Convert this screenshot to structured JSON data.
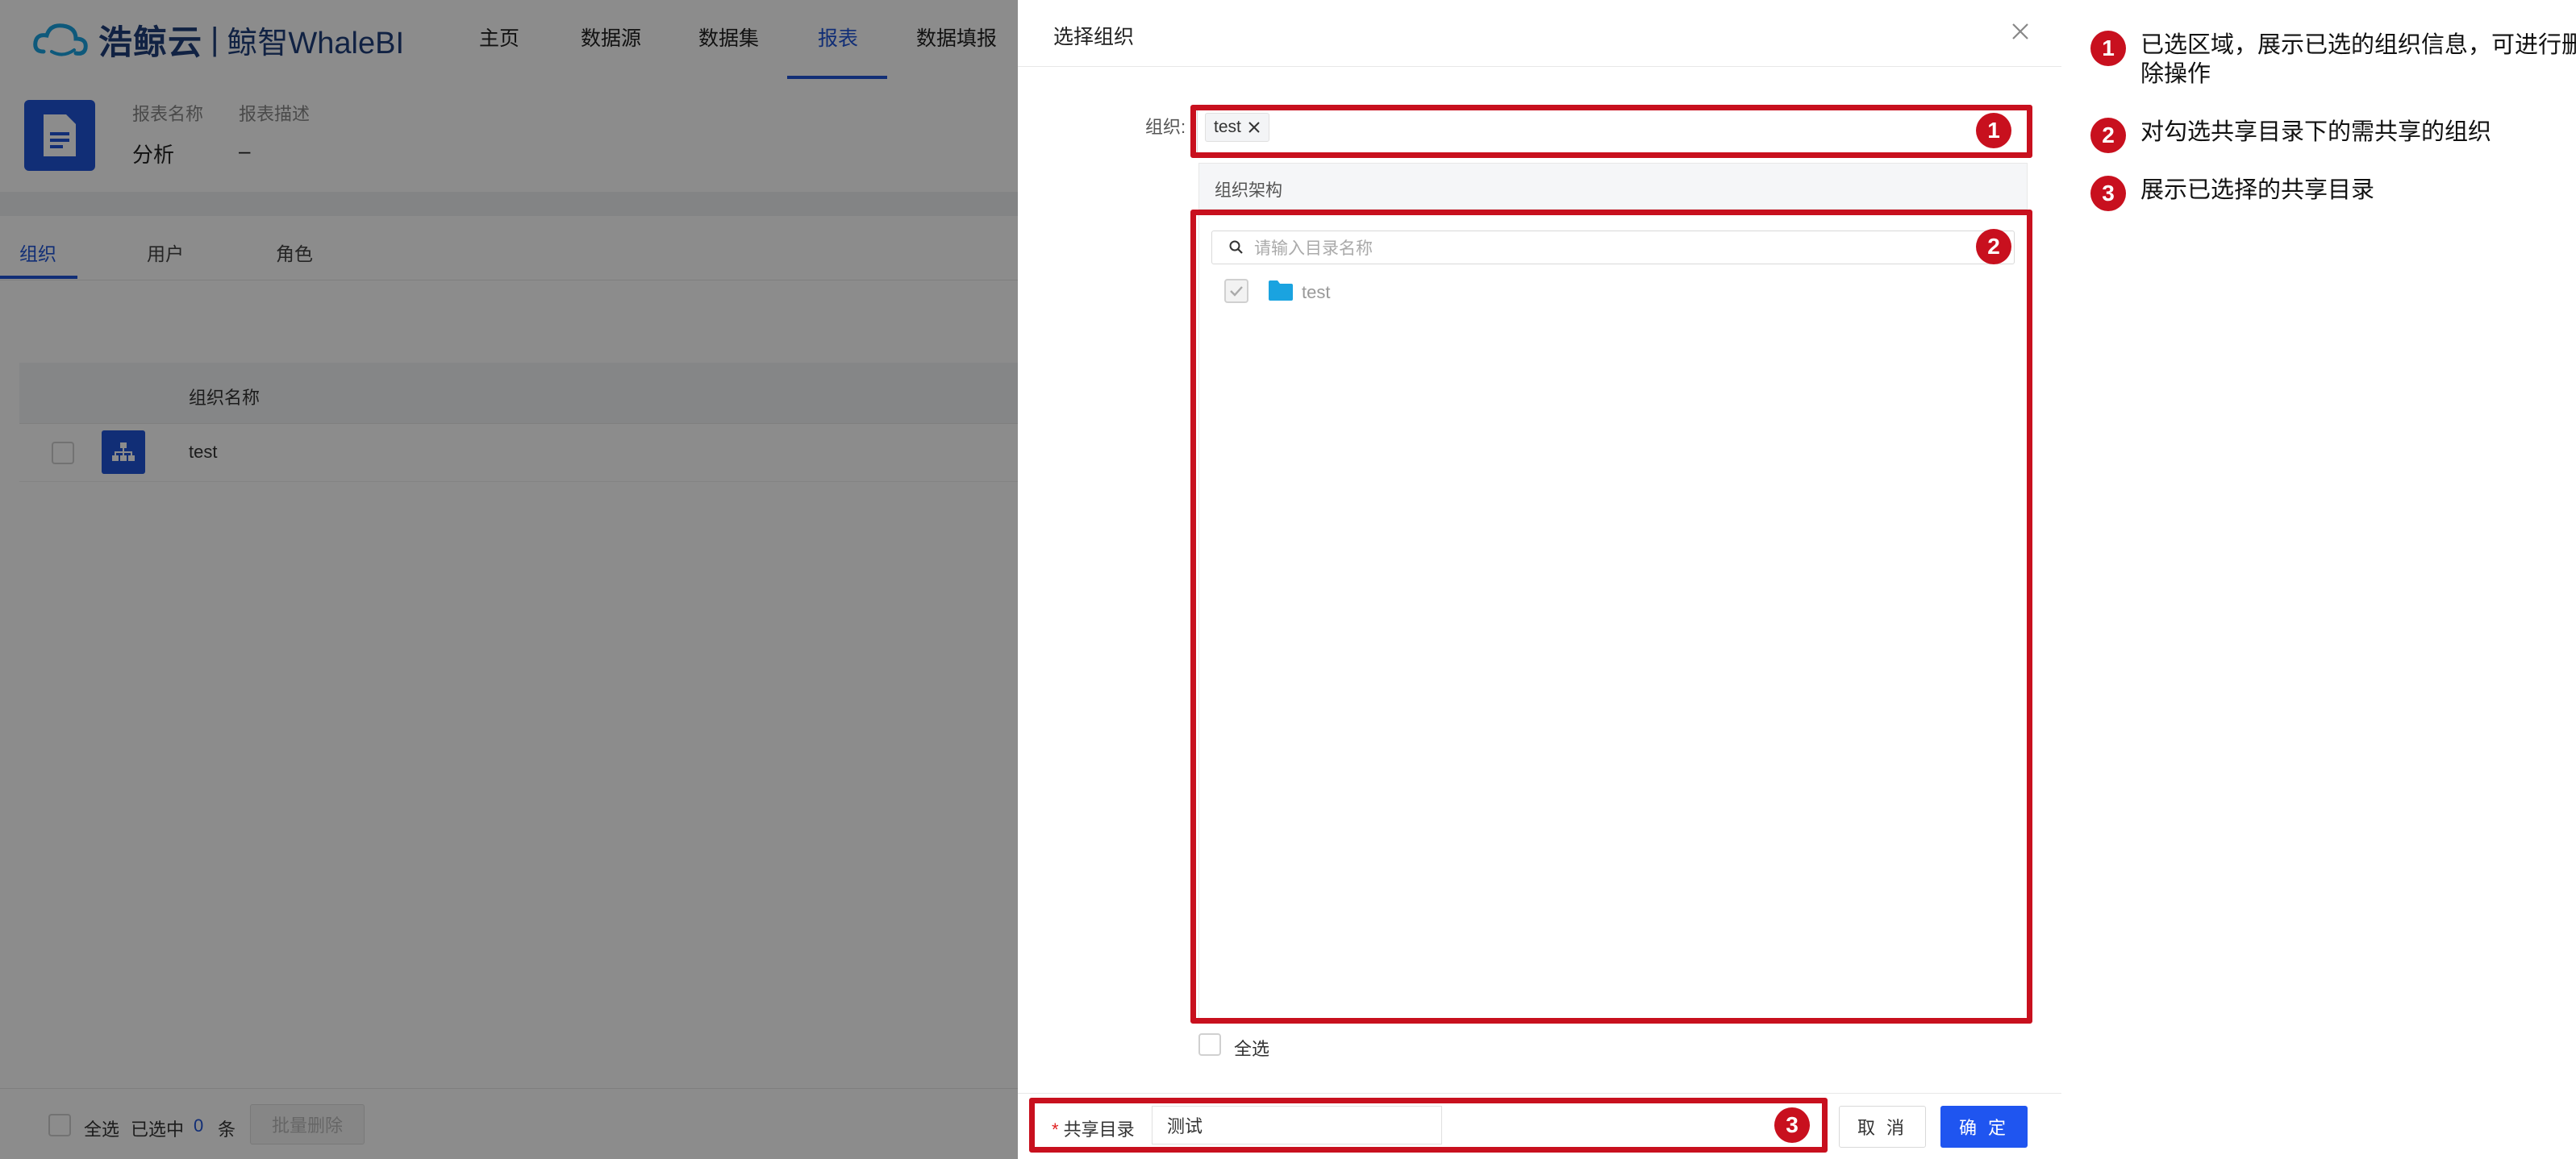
{
  "app": {
    "logo_brand": "浩鲸云",
    "logo_sep": "|",
    "logo_product": "鲸智WhaleBI",
    "nav": [
      {
        "label": "主页"
      },
      {
        "label": "数据源"
      },
      {
        "label": "数据集"
      },
      {
        "label": "报表",
        "active": true
      },
      {
        "label": "数据填报"
      }
    ],
    "report": {
      "name_label": "报表名称",
      "desc_label": "报表描述",
      "name_value": "分析",
      "desc_value": "–"
    },
    "tabs": [
      {
        "label": "组织",
        "active": true
      },
      {
        "label": "用户"
      },
      {
        "label": "角色"
      }
    ],
    "table": {
      "column": "组织名称",
      "rows": [
        {
          "name": "test"
        }
      ]
    },
    "footer": {
      "select_all": "全选",
      "selected_prefix": "已选中",
      "selected_count": "0",
      "selected_suffix": "条",
      "batch_delete": "批量删除"
    }
  },
  "drawer": {
    "title": "选择组织",
    "org_label": "组织:",
    "selected_tags": [
      {
        "label": "test"
      }
    ],
    "tree_header": "组织架构",
    "search_placeholder": "请输入目录名称",
    "tree_items": [
      {
        "label": "test"
      }
    ],
    "select_all": "全选",
    "share_required_mark": "*",
    "share_label": "共享目录",
    "share_value": "测试",
    "cancel": "取 消",
    "ok": "确 定"
  },
  "annotations": [
    {
      "num": "1",
      "text": "已选区域，展示已选的组织信息，可进行删除操作"
    },
    {
      "num": "2",
      "text": "对勾选共享目录下的需共享的组织"
    },
    {
      "num": "3",
      "text": "展示已选择的共享目录"
    }
  ],
  "colors": {
    "brand_blue": "#1f55d8",
    "primary_button": "#1f55f0",
    "annotation_red": "#c8101e",
    "folder": "#1aa3e0"
  }
}
